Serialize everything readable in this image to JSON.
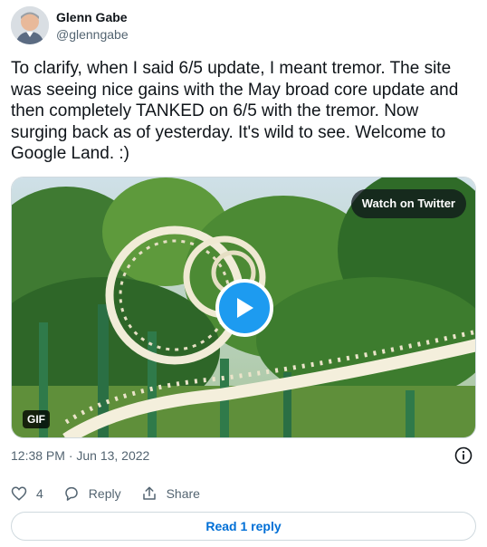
{
  "author": {
    "name": "Glenn Gabe",
    "handle": "@glenngabe",
    "avatar_icon": "avatar-photo"
  },
  "tweet": {
    "text": "To clarify, when I said 6/5 update, I meant tremor. The site was seeing nice gains with the May broad core update and then completely TANKED on 6/5 with the tremor. Now surging back as of yesterday. It's wild to see. Welcome to Google Land. :)"
  },
  "media": {
    "watch_label": "Watch on Twitter",
    "badge": "GIF",
    "play_icon": "play-icon"
  },
  "meta": {
    "timestamp": "12:38 PM · Jun 13, 2022",
    "info_icon": "info-icon"
  },
  "actions": {
    "like_count": "4",
    "reply_label": "Reply",
    "share_label": "Share"
  },
  "footer": {
    "read_reply_label": "Read 1 reply"
  },
  "colors": {
    "accent": "#1d9bf0",
    "link": "#006fd6",
    "muted": "#536471",
    "border": "#cfd9de"
  }
}
